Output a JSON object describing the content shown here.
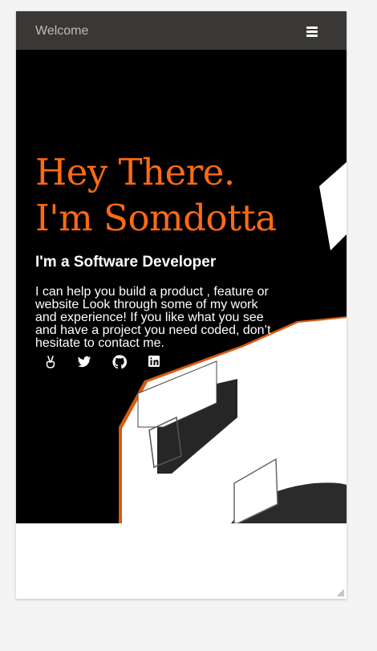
{
  "navbar": {
    "brand": "Welcome",
    "menu_icon": "hamburger-menu-icon"
  },
  "hero": {
    "title_line1": "Hey There.",
    "title_line2": "I'm Somdotta",
    "subtitle": "I'm a Software Developer",
    "description": "I can help you build a product , feature or website Look through some of my work and experience! If you like what you see and have a project you need coded, don’t hesitate to contact me.",
    "social_icons": [
      "angellist-icon",
      "twitter-icon",
      "github-icon",
      "linkedin-icon"
    ]
  },
  "colors": {
    "accent": "#ff6a13",
    "navbar_bg": "#3a3836",
    "hero_bg": "#000000",
    "page_bg": "#f4f4f4"
  }
}
